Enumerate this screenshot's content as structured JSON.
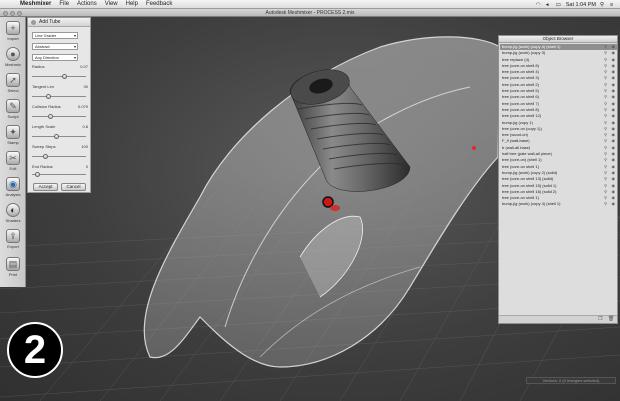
{
  "menubar": {
    "app": "Meshmixer",
    "items": [
      "File",
      "Actions",
      "View",
      "Help",
      "Feedback"
    ],
    "clock": "Sat 1:04 PM"
  },
  "window": {
    "title": "Autodesk Meshmixer - PROCESS 2.mix"
  },
  "toolbar": {
    "tools": [
      {
        "label": "Import",
        "icon": "plus-icon"
      },
      {
        "label": "Meshmix",
        "icon": "sphere-icon"
      },
      {
        "label": "Select",
        "icon": "select-arrow-icon"
      },
      {
        "label": "Sculpt",
        "icon": "brush-icon"
      },
      {
        "label": "Stamp",
        "icon": "stamp-icon"
      },
      {
        "label": "Edit",
        "icon": "edit-icon"
      },
      {
        "label": "Analysis",
        "icon": "analysis-icon"
      },
      {
        "label": "Shaders",
        "icon": "shader-ball-icon"
      },
      {
        "label": "Export",
        "icon": "export-icon"
      },
      {
        "label": "Print",
        "icon": "print-icon"
      }
    ]
  },
  "add_tube": {
    "title": "Add Tube",
    "dropdown_type": "Line Grader",
    "dropdown_mode": "Abstract",
    "dropdown_target": "Any Direction",
    "params": [
      {
        "label": "Radius",
        "value": "0.07",
        "level": 0.55
      },
      {
        "label": "Tangent Len",
        "value": "30",
        "level": 0.25
      },
      {
        "label": "Collision Radius",
        "value": "0.079",
        "level": 0.3
      },
      {
        "label": "Length Scale",
        "value": "0.8",
        "level": 0.4
      },
      {
        "label": "Sweep Steps",
        "value": "100",
        "level": 0.2
      },
      {
        "label": "End Radius",
        "value": "0",
        "level": 0.05
      }
    ],
    "accept": "Accept",
    "cancel": "Cancel"
  },
  "object_browser": {
    "title": "Object Browser",
    "items": [
      "bump-jig (work) (copy 4) (shell 1)",
      "bump-jig (work) (copy 3)",
      "tree replace (4)",
      "tree (core-on shell 8)",
      "tree (core-on shell 4)",
      "tree (core-on shell 3)",
      "tree (core-on shell 2)",
      "tree (core-on shell 5)",
      "tree (core-on shell 6)",
      "tree (core-on shell 7)",
      "tree (core-on shell 8)",
      "tree (core-on shell 12)",
      "bump-jig (copy 1)",
      "tree (core-on (copy 1))",
      "tree (wood-on)",
      "F_9 (wall-base)",
      "tr (wall-all base)",
      "half tree (pale wall-all piece)",
      "tree (core-on) (shell 1)",
      "tree (core-on shell 1)",
      "bump-jig (work) (copy 2) (solid)",
      "tree (core-on shell 13) (solid)",
      "tree (core-on shell 15) (solid 1)",
      "tree (core-on shell 16) (solid 2)",
      "tree (core-on shell 1)",
      "bump-jig (work) (copy 4) (shell 1)"
    ]
  },
  "status": "Vertices: 0 (0 triangles selected)",
  "step_badge": "2"
}
